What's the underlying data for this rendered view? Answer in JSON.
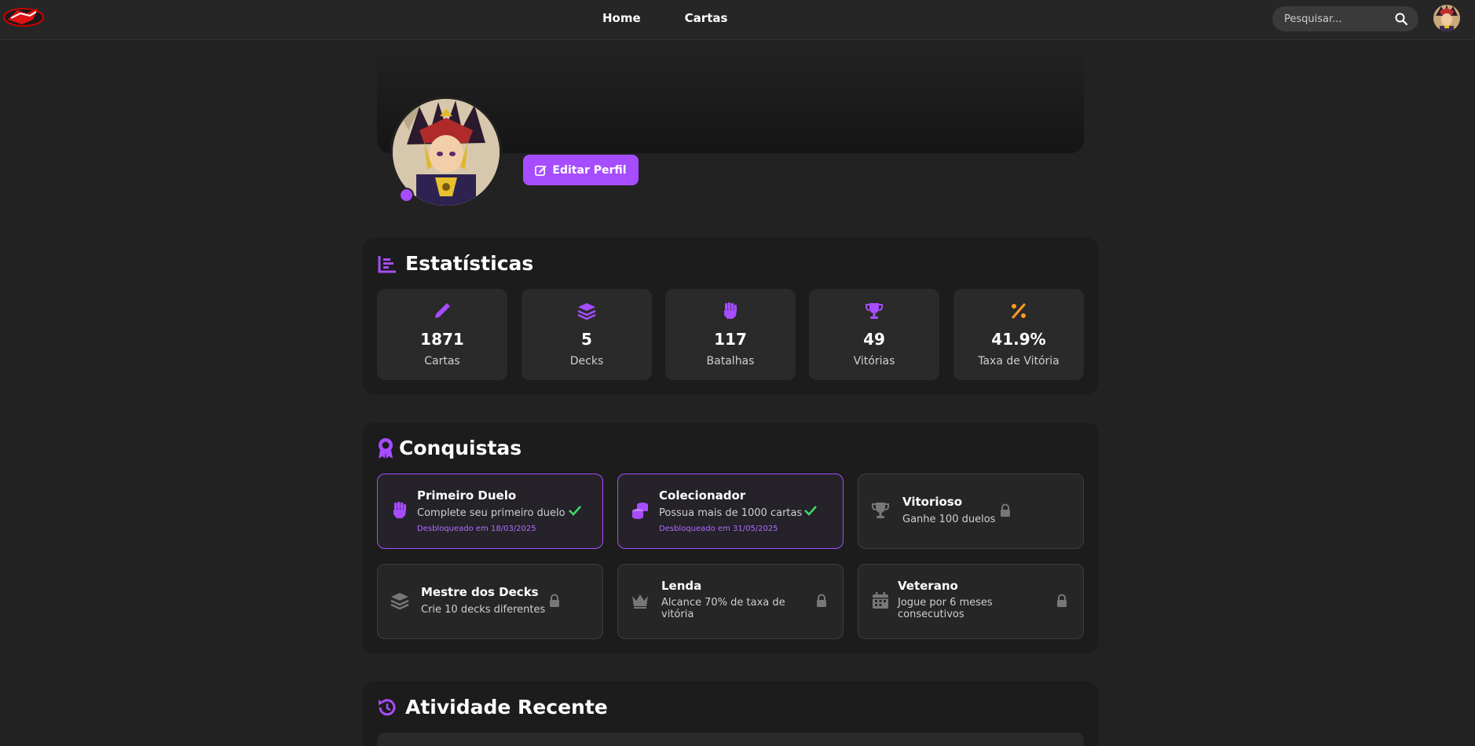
{
  "nav": {
    "links": [
      "Home",
      "Cartas"
    ],
    "search_placeholder": "Pesquisar..."
  },
  "profile": {
    "edit_label": "Editar Perfil"
  },
  "stats": {
    "title": "Estatísticas",
    "items": [
      {
        "value": "1871",
        "label": "Cartas",
        "icon": "pen-icon"
      },
      {
        "value": "5",
        "label": "Decks",
        "icon": "layers-icon"
      },
      {
        "value": "117",
        "label": "Batalhas",
        "icon": "fist-icon"
      },
      {
        "value": "49",
        "label": "Vitórias",
        "icon": "trophy-icon"
      },
      {
        "value": "41.9%",
        "label": "Taxa de Vitória",
        "icon": "percent-icon"
      }
    ]
  },
  "achievements": {
    "title": "Conquistas",
    "items": [
      {
        "name": "Primeiro Duelo",
        "desc": "Complete seu primeiro duelo",
        "date": "Desbloqueado em 18/03/2025",
        "unlocked": true
      },
      {
        "name": "Colecionador",
        "desc": "Possua mais de 1000 cartas",
        "date": "Desbloqueado em 31/05/2025",
        "unlocked": true
      },
      {
        "name": "Vitorioso",
        "desc": "Ganhe 100 duelos",
        "date": "",
        "unlocked": false
      },
      {
        "name": "Mestre dos Decks",
        "desc": "Crie 10 decks diferentes",
        "date": "",
        "unlocked": false
      },
      {
        "name": "Lenda",
        "desc": "Alcance 70% de taxa de vitória",
        "date": "",
        "unlocked": false
      },
      {
        "name": "Veterano",
        "desc": "Jogue por 6 meses consecutivos",
        "date": "",
        "unlocked": false
      }
    ]
  },
  "activity": {
    "title": "Atividade Recente"
  },
  "colors": {
    "accent": "#a64dff",
    "background": "#222222",
    "card": "#1c1c1c",
    "success": "#3ddc6b",
    "percent_icon": "#ff9a1f"
  }
}
